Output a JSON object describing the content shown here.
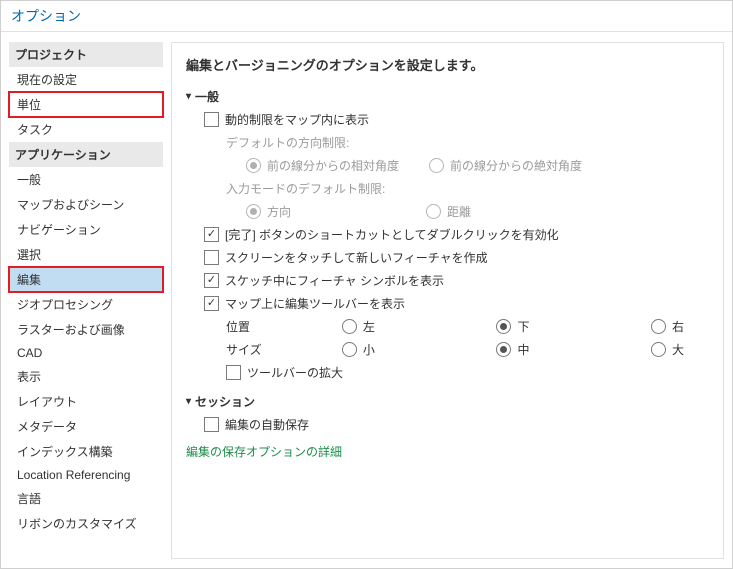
{
  "window": {
    "title": "オプション"
  },
  "sidebar": {
    "groups": [
      {
        "header": "プロジェクト",
        "items": [
          {
            "label": "現在の設定"
          },
          {
            "label": "単位"
          },
          {
            "label": "タスク"
          }
        ]
      },
      {
        "header": "アプリケーション",
        "items": [
          {
            "label": "一般"
          },
          {
            "label": "マップおよびシーン"
          },
          {
            "label": "ナビゲーション"
          },
          {
            "label": "選択"
          },
          {
            "label": "編集"
          },
          {
            "label": "ジオプロセシング"
          },
          {
            "label": "ラスターおよび画像"
          },
          {
            "label": "CAD"
          },
          {
            "label": "表示"
          },
          {
            "label": "レイアウト"
          },
          {
            "label": "メタデータ"
          },
          {
            "label": "インデックス構築"
          },
          {
            "label": "Location Referencing"
          },
          {
            "label": "言語"
          },
          {
            "label": "リボンのカスタマイズ"
          }
        ]
      }
    ]
  },
  "main": {
    "desc": "編集とバージョニングのオプションを設定します。",
    "general": {
      "title": "一般",
      "dynamic_constraints": "動的制限をマップ内に表示",
      "default_direction_label": "デフォルトの方向制限:",
      "dir_opt1": "前の線分からの相対角度",
      "dir_opt2": "前の線分からの絶対角度",
      "input_mode_label": "入力モードのデフォルト制限:",
      "input_opt1": "方向",
      "input_opt2": "距離",
      "finish_dblclick": "[完了] ボタンのショートカットとしてダブルクリックを有効化",
      "touch_create": "スクリーンをタッチして新しいフィーチャを作成",
      "show_sketch_symbol": "スケッチ中にフィーチャ シンボルを表示",
      "show_edit_toolbar": "マップ上に編集ツールバーを表示",
      "position_label": "位置",
      "pos_left": "左",
      "pos_bottom": "下",
      "pos_right": "右",
      "size_label": "サイズ",
      "size_small": "小",
      "size_medium": "中",
      "size_large": "大",
      "toolbar_expand": "ツールバーの拡大"
    },
    "session": {
      "title": "セッション",
      "auto_save": "編集の自動保存"
    },
    "save_link": "編集の保存オプションの詳細"
  }
}
